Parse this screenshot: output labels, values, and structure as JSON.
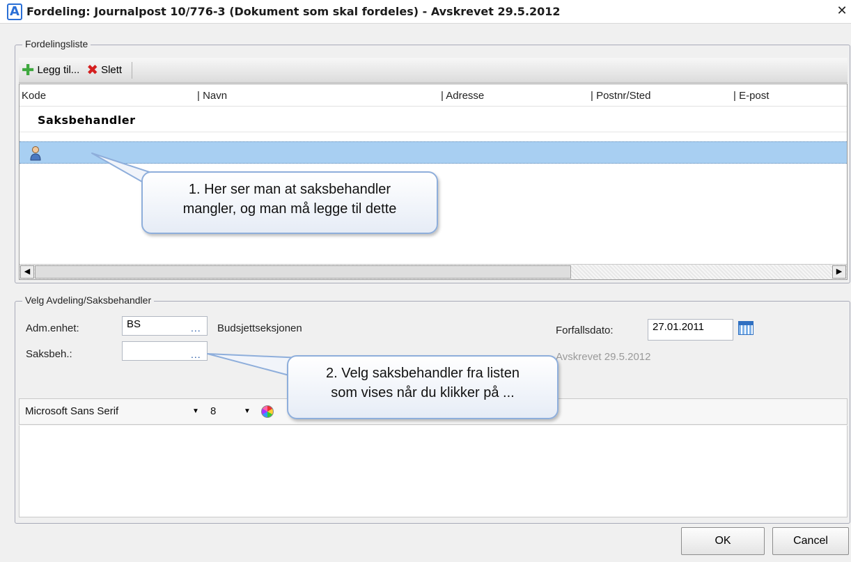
{
  "window": {
    "title": "Fordeling: Journalpost 10/776-3 (Dokument som skal fordeles) - Avskrevet 29.5.2012",
    "app_icon_letter": "A",
    "close_glyph": "✕"
  },
  "distribution_list": {
    "legend": "Fordelingsliste",
    "toolbar": {
      "add_label": "Legg til...",
      "delete_label": "Slett"
    },
    "columns": [
      "Kode",
      "Navn",
      "Adresse",
      "Postnr/Sted",
      "E-post"
    ],
    "group_label": "Saksbehandler",
    "selected_row_icon": "person-icon"
  },
  "select_section": {
    "legend": "Velg Avdeling/Saksbehandler",
    "adm_label": "Adm.enhet:",
    "adm_value": "BS",
    "adm_lookup": "...",
    "adm_description": "Budsjettseksjonen",
    "saksbeh_label": "Saksbeh.:",
    "saksbeh_value": "",
    "saksbeh_lookup": "...",
    "due_label": "Forfallsdato:",
    "due_value": "27.01.2011",
    "written_off": "Avskrevet 29.5.2012"
  },
  "font_toolbar": {
    "font_name": "Microsoft Sans Serif",
    "font_size": "8"
  },
  "buttons": {
    "ok": "OK",
    "cancel": "Cancel"
  },
  "callouts": {
    "first_line1": "1. Her ser man at saksbehandler",
    "first_line2": "mangler, og man må legge til dette",
    "second_line1": "2. Velg saksbehandler fra listen",
    "second_line2": "som vises når du klikker på ..."
  },
  "colors": {
    "selection": "#a8cff2",
    "callout_border": "#8eaedb",
    "accent": "#2a6fd6"
  }
}
